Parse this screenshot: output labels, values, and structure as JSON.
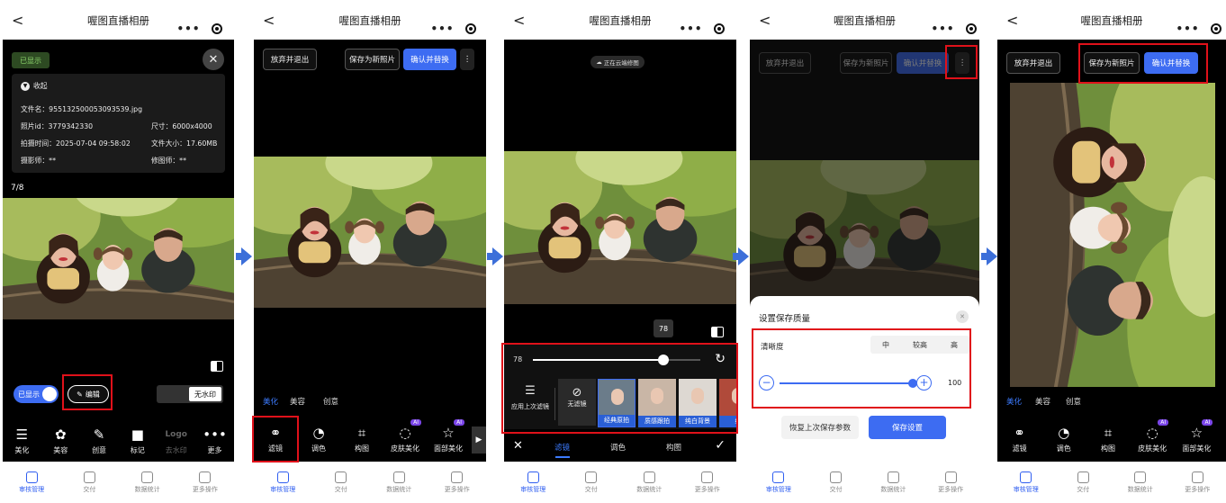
{
  "app_title": "喔图直播相册",
  "nav_back": "<",
  "nav_dots": "•••",
  "tabbar": [
    {
      "label": "审核管理",
      "icon": "review-icon"
    },
    {
      "label": "交付",
      "icon": "download-icon"
    },
    {
      "label": "数据统计",
      "icon": "stats-icon"
    },
    {
      "label": "更多操作",
      "icon": "more-icon"
    }
  ],
  "colors": {
    "accent": "#3d6cf2",
    "highlight": "#e0111a",
    "arrow": "#3c6fd9",
    "ai_badge": "#7a45e8"
  },
  "p1": {
    "shown_badge": "已显示",
    "collapse": "收起",
    "file_name": "文件名：9551325000530935​39.jpg",
    "photo_id": "照片id：3779342330",
    "size": "尺寸：6000x4000",
    "shoot_time": "拍摄时间：2025-07-04 09:58:02",
    "file_size": "文件大小：17.60MB",
    "photographer": "摄影师：**",
    "retoucher": "修图师：**",
    "counter": "7/8",
    "toggle_label": "已显示",
    "edit_label": "编辑",
    "watermark_label": "无水印",
    "toolbar": [
      {
        "label": "美化",
        "icon": "beautify-icon",
        "glyph": "☰"
      },
      {
        "label": "美容",
        "icon": "beauty-icon",
        "glyph": "✿"
      },
      {
        "label": "创意",
        "icon": "creative-icon",
        "glyph": "✎"
      },
      {
        "label": "标记",
        "icon": "mark-icon",
        "glyph": "■"
      },
      {
        "label": "去水印",
        "icon": "logo-icon",
        "glyph": "Logo"
      },
      {
        "label": "更多",
        "icon": "more-dots-icon",
        "glyph": "•••"
      }
    ]
  },
  "p2": {
    "discard": "放弃并退出",
    "save_new": "保存为新照片",
    "confirm": "确认并替换",
    "categories": [
      "美化",
      "美容",
      "创意"
    ],
    "tools": [
      {
        "label": "滤镜",
        "icon": "filter-icon",
        "glyph": "⚭"
      },
      {
        "label": "调色",
        "icon": "palette-icon",
        "glyph": "◔"
      },
      {
        "label": "构图",
        "icon": "crop-icon",
        "glyph": "⌗"
      },
      {
        "label": "皮肤美化",
        "icon": "skin-icon",
        "glyph": "◌",
        "badge": "AI"
      },
      {
        "label": "面部美化",
        "icon": "face-icon",
        "glyph": "☆",
        "badge": "AI"
      }
    ]
  },
  "p3": {
    "cloud_status": "正在云端修图",
    "slider_value": "78",
    "slider_fraction": 0.78,
    "apply_last": "应用上次滤镜",
    "no_filter": "无滤镜",
    "filters": [
      "经典原拍",
      "质感跟拍",
      "纯白背景",
      "红"
    ],
    "bottom_tabs": [
      "滤镜",
      "调色",
      "构图"
    ]
  },
  "p4": {
    "discard": "放弃并退出",
    "save_new": "保存为新照片",
    "confirm": "确认并替换",
    "sheet_title": "设置保存质量",
    "clarity_label": "清晰度",
    "levels": [
      "中",
      "较高",
      "高"
    ],
    "quality_value": "100",
    "quality_fraction": 1.0,
    "restore": "恢复上次保存参数",
    "save_settings": "保存设置"
  },
  "p5": {
    "discard": "放弃并退出",
    "save_new": "保存为新照片",
    "confirm": "确认并替换",
    "categories": [
      "美化",
      "美容",
      "创意"
    ],
    "tools": [
      {
        "label": "滤镜",
        "icon": "filter-icon",
        "glyph": "⚭"
      },
      {
        "label": "调色",
        "icon": "palette-icon",
        "glyph": "◔"
      },
      {
        "label": "构图",
        "icon": "crop-icon",
        "glyph": "⌗"
      },
      {
        "label": "皮肤美化",
        "icon": "skin-icon",
        "glyph": "◌",
        "badge": "AI"
      },
      {
        "label": "面部美化",
        "icon": "face-icon",
        "glyph": "☆",
        "badge": "AI"
      }
    ]
  }
}
